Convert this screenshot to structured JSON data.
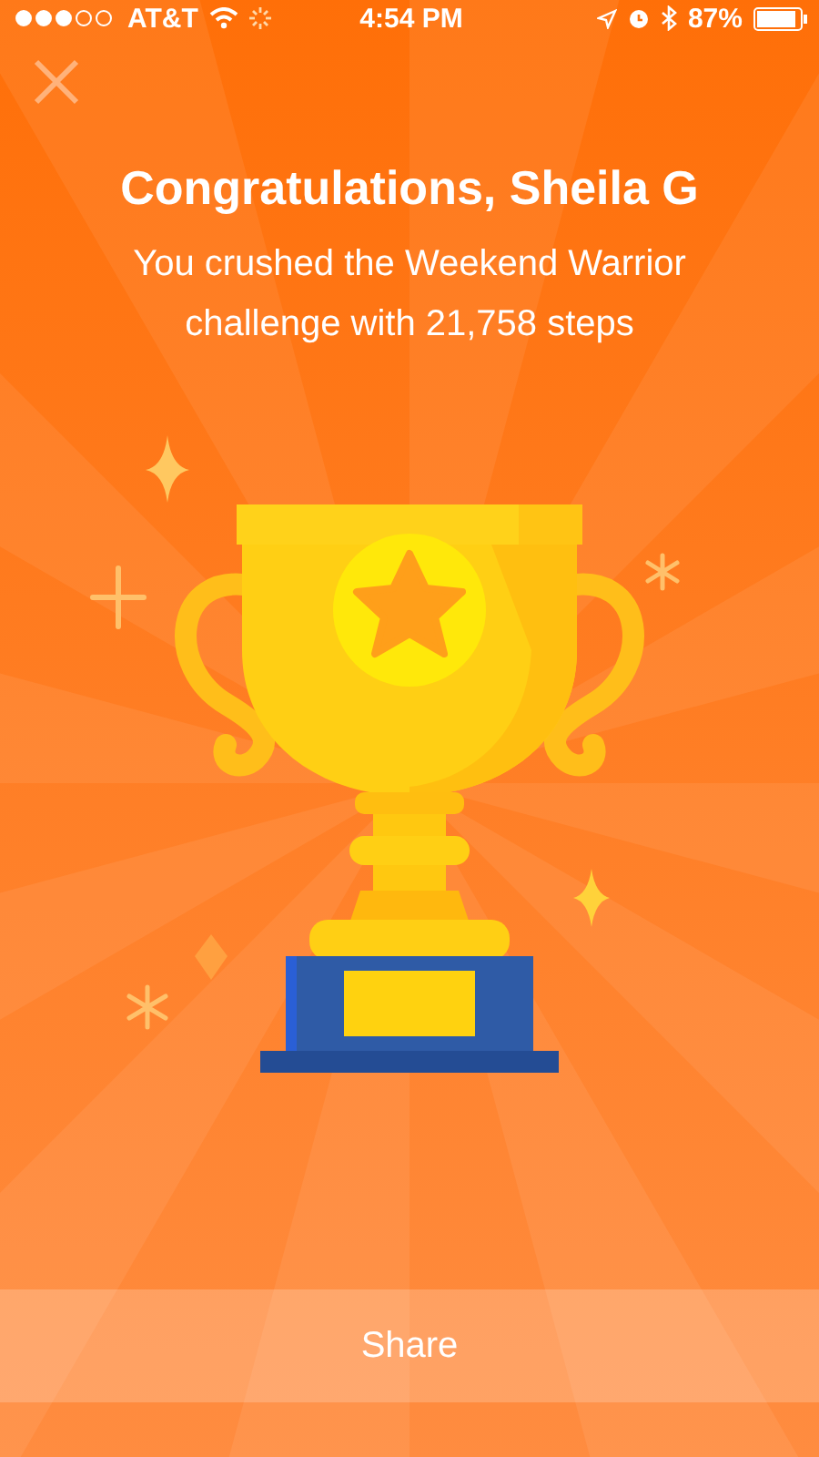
{
  "status_bar": {
    "carrier": "AT&T",
    "time": "4:54 PM",
    "battery": "87%"
  },
  "title": "Congratulations, Sheila G",
  "subtitle": "You crushed the Weekend Warrior challenge with 21,758 steps",
  "share_button": {
    "label": "Share"
  }
}
